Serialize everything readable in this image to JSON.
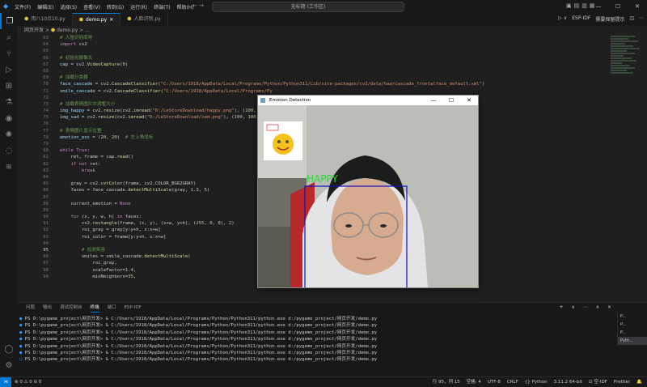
{
  "titlebar": {
    "menu": [
      "文件(F)",
      "编辑(E)",
      "选择(S)",
      "查看(V)",
      "转到(G)",
      "运行(R)",
      "终端(T)",
      "帮助(H)"
    ],
    "search": "无标题 (工作区)"
  },
  "tabs": [
    {
      "label": "用八10点10.py",
      "active": false
    },
    {
      "label": "demo.py",
      "active": true
    },
    {
      "label": "人脸识别.py",
      "active": false
    }
  ],
  "tab_tools": {
    "esp_idf": "ESP-IDF",
    "save_note": "需要保留提示"
  },
  "breadcrumb": {
    "folder": "网页开发",
    "sep": ">",
    "file": "demo.py",
    "more": "> ..."
  },
  "code_lines": [
    {
      "n": "63",
      "t": [
        [
          "c-cm",
          "# 人脸识别库导"
        ]
      ]
    },
    {
      "n": "64",
      "t": [
        [
          "c-kw",
          "import"
        ],
        [
          "code",
          " cv2"
        ]
      ]
    },
    {
      "n": "65",
      "t": []
    },
    {
      "n": "66",
      "t": [
        [
          "c-cm",
          "# 初始化摄像头"
        ]
      ]
    },
    {
      "n": "67",
      "t": [
        [
          "c-var",
          "cap"
        ],
        [
          "code",
          " = cv2."
        ],
        [
          "c-fn",
          "VideoCapture"
        ],
        [
          "code",
          "("
        ],
        [
          "c-num",
          "0"
        ],
        [
          "code",
          ")"
        ]
      ]
    },
    {
      "n": "68",
      "t": []
    },
    {
      "n": "69",
      "t": [
        [
          "c-cm",
          "# 加载分类器"
        ]
      ]
    },
    {
      "n": "70",
      "t": [
        [
          "c-var",
          "face_cascade"
        ],
        [
          "code",
          " = cv2."
        ],
        [
          "c-fn",
          "CascadeClassifier"
        ],
        [
          "code",
          "("
        ],
        [
          "c-str",
          "\"C:/Users/1918/AppData/Local/Programs/Python/Python311/Lib/site-packages/cv2/data/haarcascade_frontalface_default.xml\""
        ],
        [
          "code",
          ")"
        ]
      ]
    },
    {
      "n": "71",
      "t": [
        [
          "c-var",
          "smile_cascade"
        ],
        [
          "code",
          " = cv2."
        ],
        [
          "c-fn",
          "CascadeClassifier"
        ],
        [
          "code",
          "("
        ],
        [
          "c-str",
          "\"C:/Users/1918/AppData/Local/Programs/Py"
        ]
      ]
    },
    {
      "n": "72",
      "t": []
    },
    {
      "n": "73",
      "t": [
        [
          "c-cm",
          "# 加载表情图片并调整大小"
        ]
      ]
    },
    {
      "n": "74",
      "t": [
        [
          "c-var",
          "img_happy"
        ],
        [
          "code",
          " = cv2."
        ],
        [
          "c-fn",
          "resize"
        ],
        [
          "code",
          "(cv2."
        ],
        [
          "c-fn",
          "imread"
        ],
        [
          "code",
          "("
        ],
        [
          "c-str",
          "\"D:/LeStoreDownload/happy.png\""
        ],
        [
          "code",
          "), ("
        ],
        [
          "c-num",
          "100"
        ],
        [
          "code",
          ","
        ]
      ]
    },
    {
      "n": "75",
      "t": [
        [
          "c-var",
          "img_sad"
        ],
        [
          "code",
          " = cv2."
        ],
        [
          "c-fn",
          "resize"
        ],
        [
          "code",
          "(cv2."
        ],
        [
          "c-fn",
          "imread"
        ],
        [
          "code",
          "("
        ],
        [
          "c-str",
          "\"D:/LeStoreDownload/sad.png\""
        ],
        [
          "code",
          "), ("
        ],
        [
          "c-num",
          "100"
        ],
        [
          "code",
          ", "
        ],
        [
          "c-num",
          "100"
        ],
        [
          "code",
          ")"
        ]
      ]
    },
    {
      "n": "76",
      "t": []
    },
    {
      "n": "77",
      "t": [
        [
          "c-cm",
          "# 表情图片显示位置"
        ]
      ]
    },
    {
      "n": "78",
      "t": [
        [
          "c-var",
          "emotion_pos"
        ],
        [
          "code",
          " = ("
        ],
        [
          "c-num",
          "20"
        ],
        [
          "code",
          ", "
        ],
        [
          "c-num",
          "20"
        ],
        [
          "code",
          ")  "
        ],
        [
          "c-cm",
          "# 左上角坐标"
        ]
      ]
    },
    {
      "n": "79",
      "t": []
    },
    {
      "n": "80",
      "t": [
        [
          "c-kw",
          "while"
        ],
        [
          "code",
          " "
        ],
        [
          "c-kw",
          "True"
        ],
        [
          "code",
          ":"
        ]
      ]
    },
    {
      "n": "81",
      "t": [
        [
          "code",
          "    ret, frame = cap."
        ],
        [
          "c-fn",
          "read"
        ],
        [
          "code",
          "()"
        ]
      ]
    },
    {
      "n": "82",
      "t": [
        [
          "code",
          "    "
        ],
        [
          "c-kw",
          "if not"
        ],
        [
          "code",
          " ret:"
        ]
      ]
    },
    {
      "n": "83",
      "t": [
        [
          "code",
          "        "
        ],
        [
          "c-kw",
          "break"
        ]
      ]
    },
    {
      "n": "84",
      "t": []
    },
    {
      "n": "85",
      "t": [
        [
          "code",
          "    gray = cv2."
        ],
        [
          "c-fn",
          "cvtColor"
        ],
        [
          "code",
          "(frame, cv2.COLOR_BGR2GRAY)"
        ]
      ]
    },
    {
      "n": "86",
      "t": [
        [
          "code",
          "    faces = face_cascade."
        ],
        [
          "c-fn",
          "detectMultiScale"
        ],
        [
          "code",
          "(gray, "
        ],
        [
          "c-num",
          "1.3"
        ],
        [
          "code",
          ", "
        ],
        [
          "c-num",
          "5"
        ],
        [
          "code",
          ")"
        ]
      ]
    },
    {
      "n": "87",
      "t": []
    },
    {
      "n": "88",
      "t": [
        [
          "code",
          "    current_emotion = "
        ],
        [
          "c-kw",
          "None"
        ]
      ]
    },
    {
      "n": "89",
      "t": []
    },
    {
      "n": "90",
      "t": [
        [
          "code",
          "    "
        ],
        [
          "c-kw",
          "for"
        ],
        [
          "code",
          " (x, y, w, h) "
        ],
        [
          "c-kw",
          "in"
        ],
        [
          "code",
          " faces:"
        ]
      ]
    },
    {
      "n": "91",
      "t": [
        [
          "code",
          "        cv2."
        ],
        [
          "c-fn",
          "rectangle"
        ],
        [
          "code",
          "(frame, (x, y), (x+w, y+h), ("
        ],
        [
          "c-num",
          "255"
        ],
        [
          "code",
          ", "
        ],
        [
          "c-num",
          "0"
        ],
        [
          "code",
          ", "
        ],
        [
          "c-num",
          "0"
        ],
        [
          "code",
          "), "
        ],
        [
          "c-num",
          "2"
        ],
        [
          "code",
          ")"
        ]
      ]
    },
    {
      "n": "92",
      "t": [
        [
          "code",
          "        roi_gray = gray[y:y+h, x:x+w]"
        ]
      ]
    },
    {
      "n": "93",
      "t": [
        [
          "code",
          "        roi_color = frame[y:y+h, x:x+w]"
        ]
      ]
    },
    {
      "n": "94",
      "t": []
    },
    {
      "n": "95",
      "t": [
        [
          "code",
          "        "
        ],
        [
          "c-cm",
          "# 检测笑容"
        ]
      ]
    },
    {
      "n": "96",
      "t": [
        [
          "code",
          "        smiles = smile_cascade."
        ],
        [
          "c-fn",
          "detectMultiScale"
        ],
        [
          "code",
          "("
        ]
      ]
    },
    {
      "n": "97",
      "t": [
        [
          "code",
          "            roi_gray,"
        ]
      ]
    },
    {
      "n": "98",
      "t": [
        [
          "code",
          "            scaleFactor="
        ],
        [
          "c-num",
          "1.4"
        ],
        [
          "code",
          ","
        ]
      ]
    },
    {
      "n": "99",
      "t": [
        [
          "code",
          "            minNeighbors="
        ],
        [
          "c-num",
          "35"
        ],
        [
          "code",
          ","
        ]
      ]
    }
  ],
  "panel": {
    "tabs": [
      "问题",
      "输出",
      "调试控制台",
      "终端",
      "端口",
      "ESP-IDF"
    ],
    "active": "终端",
    "tools": "+ ∨ ⋯ ∧ ×",
    "prompt_prefix": "PS D:\\pygame_project\\网页开发> & C:/Users/1918/AppData/Local/Programs/Python/Python311/python.exe d:/pygame_project/网页开发/demo.py",
    "prompt_last": "PS D:\\pygame_project\\网页开发> & C:/Users/1918/AppData/Local/Programs/Python/Python311/python.exe d:/pygame_project/网页开发/demo.py",
    "term_list": [
      "P...",
      "P...",
      "P...",
      "Pyth..."
    ]
  },
  "statusbar": {
    "left": "⊗ 0 ⚠ 0  ⊘ 0",
    "position": "行 95，列 15",
    "spaces": "空格: 4",
    "encoding": "UTF-8",
    "eol": "CRLF",
    "lang": "{} Python",
    "interp": "3.11.2 64-bit",
    "flag": "⊡ 空-IDF",
    "prettier": "Prettier"
  },
  "cv_window": {
    "title": "Emotion Detection",
    "label": "HAPPY",
    "label_color": "#22e02e",
    "box_color": "#1010c0"
  }
}
